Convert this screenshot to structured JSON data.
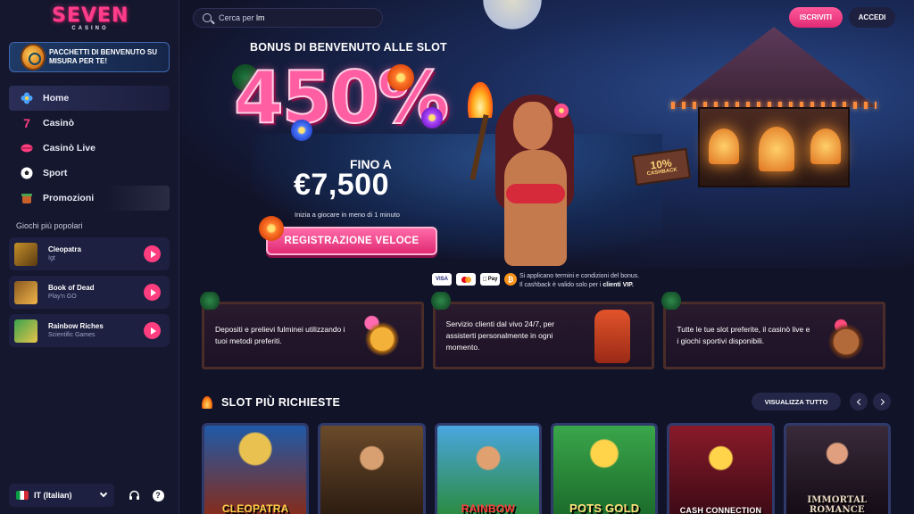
{
  "brand": {
    "name": "SEVEN",
    "sub": "CASINO",
    "accent": "#ff3d8b"
  },
  "header": {
    "search_placeholder_prefix": "Cerca per",
    "search_value": "lm",
    "register_label": "ISCRIVITI",
    "login_label": "ACCEDI"
  },
  "sidebar": {
    "promo_text": "PACCHETTI DI BENVENUTO SU MISURA PER TE!",
    "items": [
      {
        "label": "Home",
        "icon": "home-flower-icon",
        "active": true
      },
      {
        "label": "Casinò",
        "icon": "seven-icon"
      },
      {
        "label": "Casinò Live",
        "icon": "live-lips-icon"
      },
      {
        "label": "Sport",
        "icon": "soccer-ball-icon"
      },
      {
        "label": "Promozioni",
        "icon": "tiki-gift-icon"
      }
    ],
    "popular_label": "Giochi più popolari",
    "popular_games": [
      {
        "name": "Cleopatra",
        "provider": "Igt"
      },
      {
        "name": "Book of Dead",
        "provider": "Play'n GO"
      },
      {
        "name": "Rainbow Riches",
        "provider": "Scientific Games"
      }
    ],
    "language": "IT (Italian)"
  },
  "hero": {
    "title": "BONUS DI BENVENUTO ALLE SLOT",
    "percent": "450%",
    "up_to": "FINO A",
    "amount": "€7,500",
    "hint": "Inizia a giocare in meno di 1 minuto",
    "cta_label": "REGISTRAZIONE VELOCE",
    "cashback_big": "10%",
    "cashback_small": "CASHBACK"
  },
  "payments": {
    "visa": "VISA",
    "applepay": "Pay",
    "btc": "₿",
    "terms_line1": "Si applicano termini e condizioni del bonus.",
    "terms_line2_prefix": "Il cashback è valido solo per i",
    "terms_line2_bold": "clienti VIP."
  },
  "features": [
    {
      "text": "Depositi e prelievi fulminei utilizzando i tuoi metodi preferiti."
    },
    {
      "text": "Servizio clienti dal vivo 24/7, per assisterti personalmente in ogni momento."
    },
    {
      "text": "Tutte le tue slot preferite, il casinò live e i giochi sportivi disponibili."
    }
  ],
  "slots": {
    "title": "SLOT PIÙ RICHIESTE",
    "view_all": "VISUALIZZA TUTTO",
    "games": [
      {
        "name": "CLEOPATRA"
      },
      {
        "name": ""
      },
      {
        "name": "RAINBOW"
      },
      {
        "name": "POTS GOLD"
      },
      {
        "name": "CASH CONNECTION"
      },
      {
        "name": "IMMORTAL ROMANCE"
      }
    ]
  }
}
